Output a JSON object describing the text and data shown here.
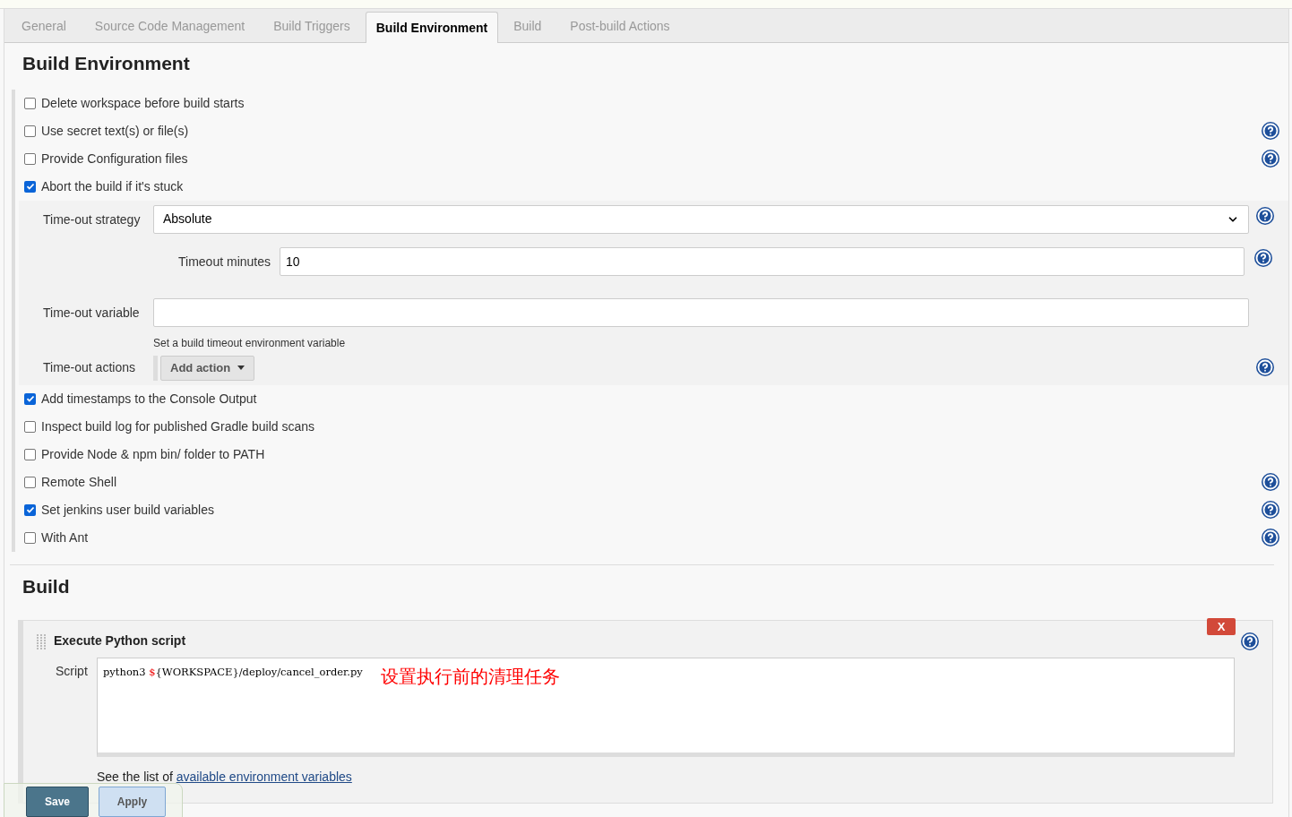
{
  "tabs": [
    {
      "label": "General",
      "selected": false
    },
    {
      "label": "Source Code Management",
      "selected": false
    },
    {
      "label": "Build Triggers",
      "selected": false
    },
    {
      "label": "Build Environment",
      "selected": true
    },
    {
      "label": "Build",
      "selected": false
    },
    {
      "label": "Post-build Actions",
      "selected": false
    }
  ],
  "environment": {
    "title": "Build Environment",
    "options": [
      {
        "label": "Delete workspace before build starts",
        "checked": false,
        "help": false
      },
      {
        "label": "Use secret text(s) or file(s)",
        "checked": false,
        "help": true
      },
      {
        "label": "Provide Configuration files",
        "checked": false,
        "help": true
      },
      {
        "label": "Abort the build if it's stuck",
        "checked": true,
        "help": false,
        "settings": {
          "strategy": {
            "label": "Time-out strategy",
            "value": "Absolute",
            "help": true
          },
          "minutes": {
            "label": "Timeout minutes",
            "value": "10",
            "help": true
          },
          "variable": {
            "label": "Time-out variable",
            "hint": "Set a build timeout environment variable"
          },
          "actions": {
            "label": "Time-out actions",
            "button": "Add action",
            "help": true
          }
        }
      },
      {
        "label": "Add timestamps to the Console Output",
        "checked": true,
        "help": false
      },
      {
        "label": "Inspect build log for published Gradle build scans",
        "checked": false,
        "help": false
      },
      {
        "label": "Provide Node & npm bin/ folder to PATH",
        "checked": false,
        "help": false
      },
      {
        "label": "Remote Shell",
        "checked": false,
        "help": true
      },
      {
        "label": "Set jenkins user build variables",
        "checked": true,
        "help": true
      },
      {
        "label": "With Ant",
        "checked": false,
        "help": true
      }
    ]
  },
  "build": {
    "title": "Build",
    "step": {
      "title": "Execute Python script",
      "delete": "X",
      "script_label": "Script",
      "script": [
        {
          "kind": "plain",
          "text": "python3 "
        },
        {
          "kind": "variable",
          "text": "$"
        },
        {
          "kind": "plain",
          "text": "{WORKSPACE}/deploy/cancel_order.py"
        }
      ],
      "annotation": "设置执行前的清理任务",
      "note": "See the list of ",
      "link": "available environment variables"
    }
  },
  "buttons": [
    {
      "label": "Save",
      "kind": "primary"
    },
    {
      "label": "Apply",
      "kind": "secondary"
    }
  ]
}
